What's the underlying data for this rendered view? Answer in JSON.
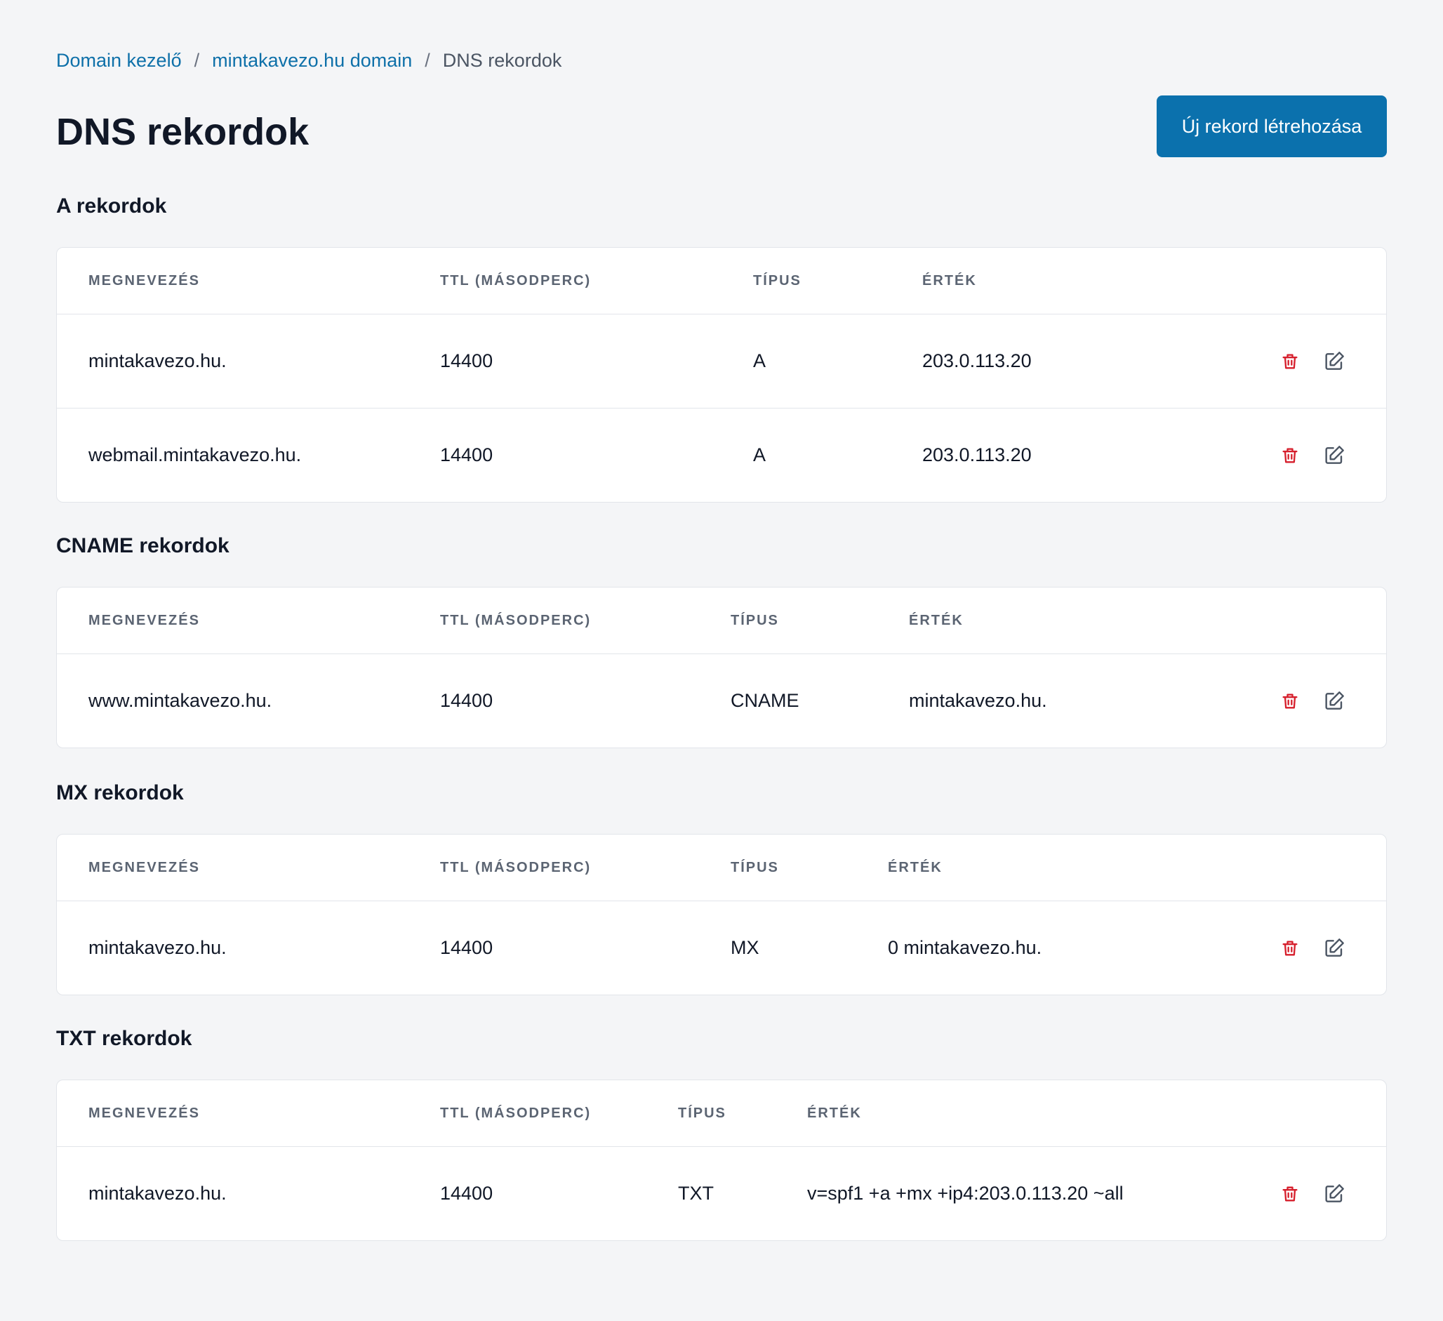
{
  "breadcrumb": {
    "items": [
      "Domain kezelő",
      "mintakavezo.hu domain"
    ],
    "current": "DNS rekordok",
    "separator": "/"
  },
  "page_title": "DNS rekordok",
  "create_button": "Új rekord létrehozása",
  "columns": {
    "name": "MEGNEVEZÉS",
    "ttl": "TTL (MÁSODPERC)",
    "type": "TÍPUS",
    "value": "ÉRTÉK"
  },
  "icons": {
    "delete": "trash-icon",
    "edit": "edit-icon"
  },
  "colors": {
    "accent": "#0b71ad",
    "link": "#0e70a9",
    "danger": "#d61f2c",
    "background": "#f4f5f7"
  },
  "sections": {
    "a": {
      "title": "A rekordok",
      "rows": [
        {
          "name": "mintakavezo.hu.",
          "ttl": "14400",
          "type": "A",
          "value": "203.0.113.20"
        },
        {
          "name": "webmail.mintakavezo.hu.",
          "ttl": "14400",
          "type": "A",
          "value": "203.0.113.20"
        }
      ]
    },
    "cname": {
      "title": "CNAME rekordok",
      "rows": [
        {
          "name": "www.mintakavezo.hu.",
          "ttl": "14400",
          "type": "CNAME",
          "value": "mintakavezo.hu."
        }
      ]
    },
    "mx": {
      "title": "MX rekordok",
      "rows": [
        {
          "name": "mintakavezo.hu.",
          "ttl": "14400",
          "type": "MX",
          "value": "0 mintakavezo.hu."
        }
      ]
    },
    "txt": {
      "title": "TXT rekordok",
      "rows": [
        {
          "name": "mintakavezo.hu.",
          "ttl": "14400",
          "type": "TXT",
          "value": "v=spf1 +a +mx +ip4:203.0.113.20 ~all"
        }
      ]
    }
  }
}
